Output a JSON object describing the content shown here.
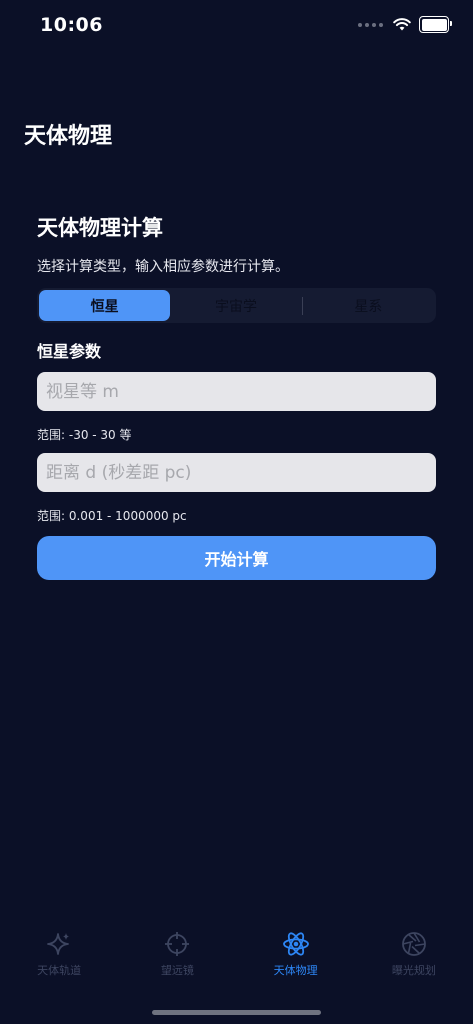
{
  "status_bar": {
    "time": "10:06"
  },
  "nav": {
    "title": "天体物理"
  },
  "calculator": {
    "title": "天体物理计算",
    "subtitle": "选择计算类型，输入相应参数进行计算。",
    "segments": [
      {
        "label": "恒星",
        "selected": true
      },
      {
        "label": "宇宙学",
        "selected": false
      },
      {
        "label": "星系",
        "selected": false
      }
    ],
    "section_label": "恒星参数",
    "fields": [
      {
        "placeholder": "视星等 m",
        "value": "",
        "hint": "范围: -30 - 30 等"
      },
      {
        "placeholder": "距离 d (秒差距 pc)",
        "value": "",
        "hint": "范围: 0.001 - 1000000 pc"
      }
    ],
    "submit_label": "开始计算"
  },
  "tabs": [
    {
      "label": "天体轨道",
      "icon": "sparkle-icon",
      "active": false
    },
    {
      "label": "望远镜",
      "icon": "crosshair-icon",
      "active": false
    },
    {
      "label": "天体物理",
      "icon": "atom-icon",
      "active": true
    },
    {
      "label": "曝光规划",
      "icon": "aperture-icon",
      "active": false
    }
  ],
  "colors": {
    "background": "#0b1027",
    "accent": "#4f95f7",
    "tab_active": "#2d86f5",
    "tab_inactive": "#3d4560"
  }
}
